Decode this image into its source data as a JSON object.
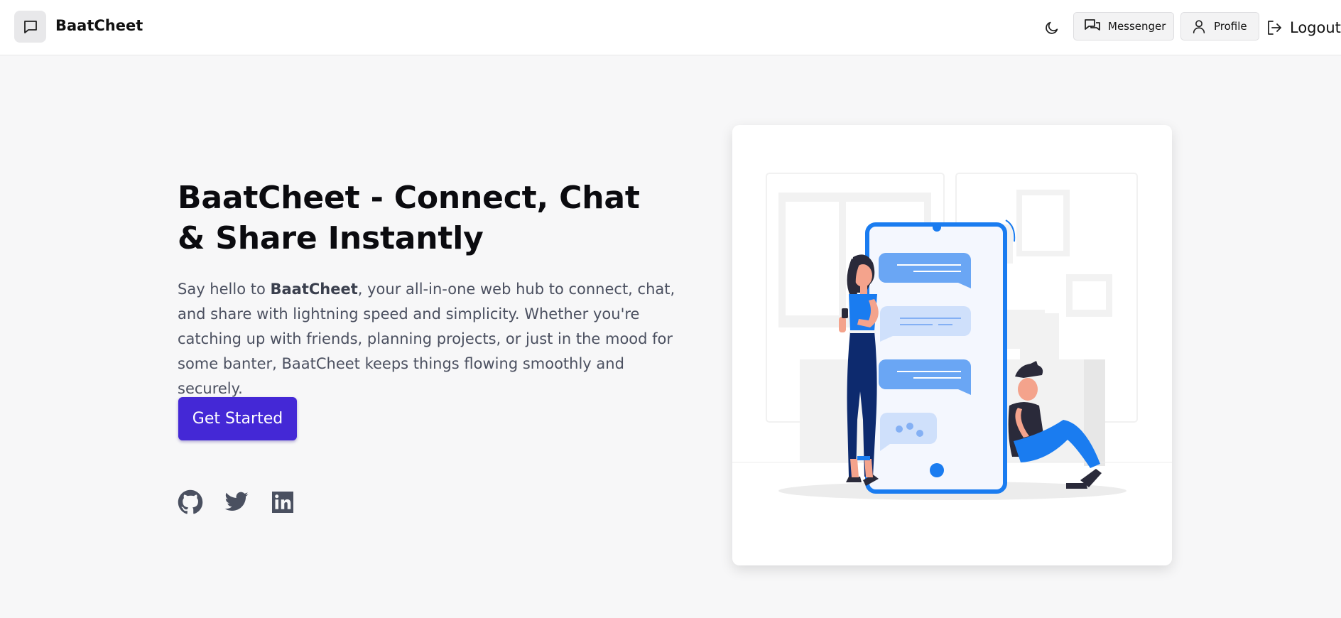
{
  "nav": {
    "brand": "BaatCheet",
    "messenger_label": "Messenger",
    "profile_label": "Profile",
    "logout_label": "Logout"
  },
  "hero": {
    "title": "BaatCheet - Connect, Chat & Share Instantly",
    "desc_prefix": "Say hello to ",
    "desc_brand": "BaatCheet",
    "desc_rest": ", your all-in-one web hub to connect, chat, and share with lightning speed and simplicity. Whether you're catching up with friends, planning projects, or just in the mood for some banter, BaatCheet keeps things flowing smoothly and securely.",
    "cta_label": "Get Started"
  },
  "social": [
    "github-icon",
    "twitter-icon",
    "linkedin-icon"
  ],
  "colors": {
    "accent": "#4428d6",
    "illustration_blue": "#1a7cf0",
    "background": "#f7f7f8"
  }
}
